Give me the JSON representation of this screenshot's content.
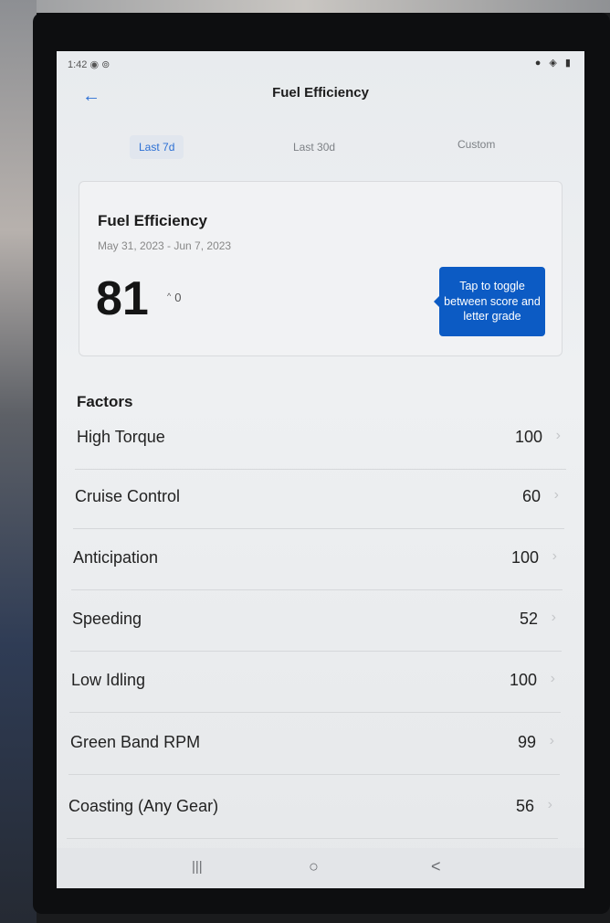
{
  "status_bar": {
    "time": "1:42",
    "icons": "◉ ⊚",
    "right_icons": "● ◈ ▮"
  },
  "header": {
    "title": "Fuel Efficiency",
    "back_glyph": "←"
  },
  "tabs": [
    {
      "label": "Last 7d",
      "active": true
    },
    {
      "label": "Last 30d",
      "active": false
    },
    {
      "label": "Custom",
      "active": false
    }
  ],
  "card": {
    "title": "Fuel Efficiency",
    "date_range": "May 31, 2023 - Jun 7, 2023",
    "score": "81",
    "delta": "0",
    "tooltip": "Tap to toggle between score and letter grade"
  },
  "factors": {
    "heading": "Factors",
    "items": [
      {
        "label": "High Torque",
        "value": "100"
      },
      {
        "label": "Cruise Control",
        "value": "60"
      },
      {
        "label": "Anticipation",
        "value": "100"
      },
      {
        "label": "Speeding",
        "value": "52"
      },
      {
        "label": "Low Idling",
        "value": "100"
      },
      {
        "label": "Green Band RPM",
        "value": "99"
      },
      {
        "label": "Coasting (Any Gear)",
        "value": "56"
      }
    ]
  },
  "nav": {
    "recents": "|||",
    "home": "○",
    "back": "<"
  },
  "colors": {
    "accent": "#2b6fd4",
    "tooltip": "#0c5bc4"
  }
}
